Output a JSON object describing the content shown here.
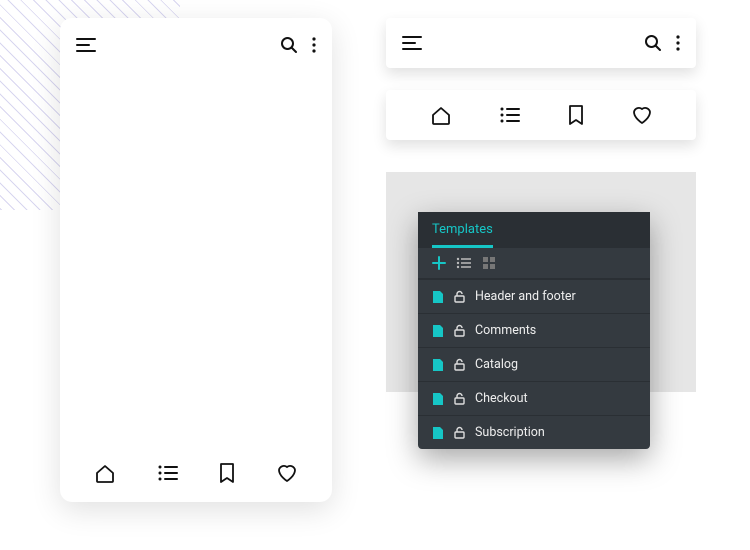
{
  "colors": {
    "accent": "#16c6c6",
    "panel_bg": "#343a40",
    "panel_header_bg": "#2a2f34"
  },
  "phone": {
    "header": {
      "menu": "menu",
      "search": "search",
      "more": "more"
    },
    "footer": {
      "home": "home",
      "list": "list",
      "bookmark": "bookmark",
      "heart": "heart"
    }
  },
  "header_bar": {
    "menu": "menu",
    "search": "search",
    "more": "more"
  },
  "footer_bar": {
    "home": "home",
    "list": "list",
    "bookmark": "bookmark",
    "heart": "heart"
  },
  "templates": {
    "title": "Templates",
    "toolbar": {
      "add": "add",
      "view_list": "list-view",
      "view_grid": "grid-view"
    },
    "items": [
      {
        "label": "Header and footer"
      },
      {
        "label": "Comments"
      },
      {
        "label": "Catalog"
      },
      {
        "label": "Checkout"
      },
      {
        "label": "Subscription"
      }
    ]
  }
}
